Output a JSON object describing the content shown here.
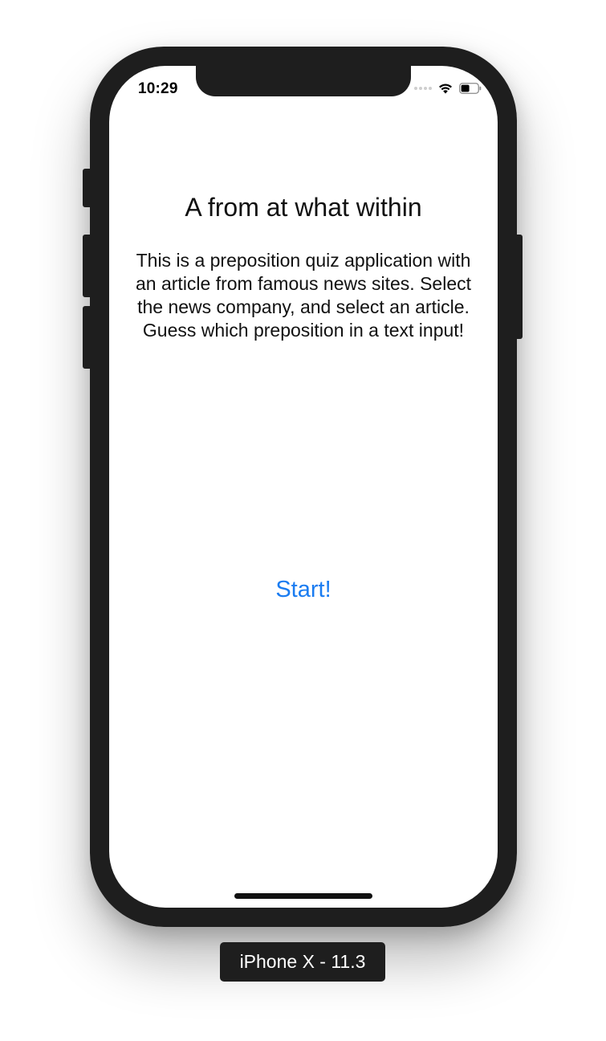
{
  "status_bar": {
    "time": "10:29",
    "icons": [
      "signal-dots-icon",
      "wifi-icon",
      "battery-icon"
    ]
  },
  "main": {
    "title": "A from at what within",
    "description": "This is a preposition quiz application with an article from famous news sites. Select the news company, and select an article. Guess which preposition in a text input!",
    "start_label": "Start!"
  },
  "simulator": {
    "device_label": "iPhone X - 11.3"
  },
  "colors": {
    "accent": "#1a7cf1",
    "device_frame": "#1e1e1e",
    "background": "#ffffff"
  }
}
